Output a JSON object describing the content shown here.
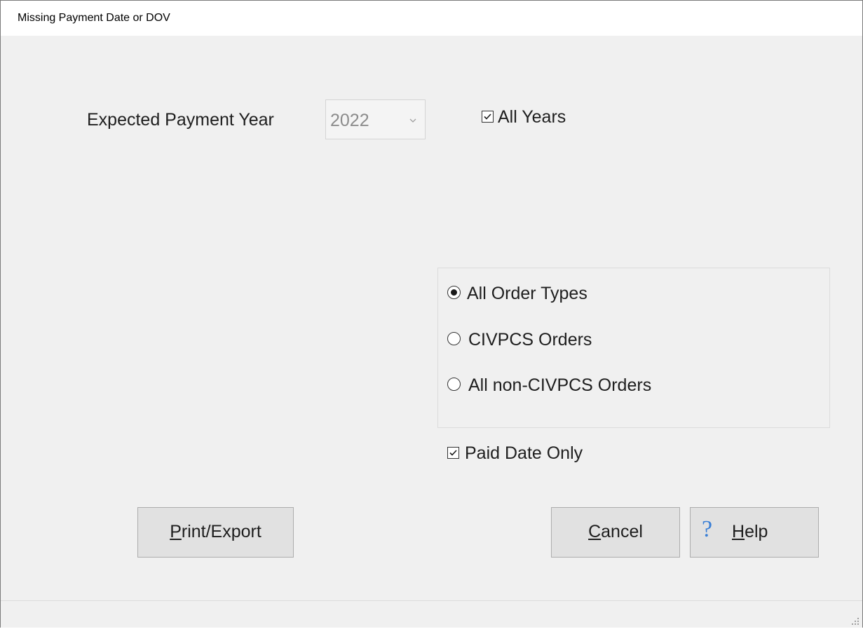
{
  "window": {
    "title": "Missing Payment Date or DOV"
  },
  "year_filter": {
    "label": "Expected Payment Year",
    "selected_value": "2022",
    "enabled": false,
    "all_years_label": "All Years",
    "all_years_checked": true
  },
  "order_types": {
    "options": [
      {
        "label": "All Order Types",
        "selected": true
      },
      {
        "label": "CIVPCS Orders",
        "selected": false
      },
      {
        "label": "All non-CIVPCS Orders",
        "selected": false
      }
    ]
  },
  "paid_date_only": {
    "label": "Paid Date Only",
    "checked": true
  },
  "buttons": {
    "print_export": {
      "mnemonic": "P",
      "rest": "rint/Export"
    },
    "cancel": {
      "mnemonic": "C",
      "rest": "ancel"
    },
    "help": {
      "icon": "?",
      "mnemonic": "H",
      "rest": "elp"
    }
  },
  "colors": {
    "window_bg": "#f0f0f0",
    "title_bg": "#ffffff",
    "button_bg": "#e1e1e1",
    "help_icon": "#3a7fd6",
    "disabled_text": "#8c8c8c"
  }
}
